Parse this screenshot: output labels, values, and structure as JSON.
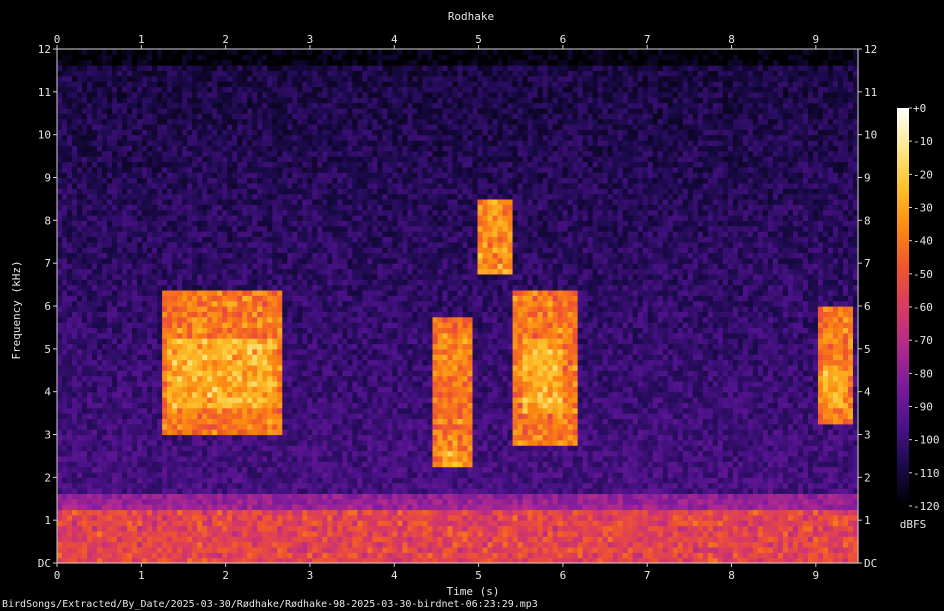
{
  "chart_data": {
    "type": "heatmap",
    "title": "Rodhake",
    "xlabel": "Time (s)",
    "ylabel": "Frequency (kHz)",
    "xlim": [
      0,
      9.5
    ],
    "ylim": [
      0,
      12
    ],
    "x_ticks": [
      "0",
      "1",
      "2",
      "3",
      "4",
      "5",
      "6",
      "7",
      "8",
      "9"
    ],
    "x_tick_values": [
      0,
      1,
      2,
      3,
      4,
      5,
      6,
      7,
      8,
      9
    ],
    "y_ticks": [
      "DC",
      "1",
      "2",
      "3",
      "4",
      "5",
      "6",
      "7",
      "8",
      "9",
      "10",
      "11",
      "12"
    ],
    "y_tick_values": [
      0,
      1,
      2,
      3,
      4,
      5,
      6,
      7,
      8,
      9,
      10,
      11,
      12
    ],
    "colorbar": {
      "label": "dBFS",
      "ticks": [
        "+0",
        "-10",
        "-20",
        "-30",
        "-40",
        "-50",
        "-60",
        "-70",
        "-80",
        "-90",
        "-100",
        "-110",
        "-120"
      ],
      "tick_values": [
        0,
        -10,
        -20,
        -30,
        -40,
        -50,
        -60,
        -70,
        -80,
        -90,
        -100,
        -110,
        -120
      ],
      "range": [
        -120,
        0
      ],
      "colors": [
        "#000000",
        "#1a0a4a",
        "#4b1289",
        "#7a1a9c",
        "#b02a8c",
        "#d93a62",
        "#f0552e",
        "#fb8a12",
        "#fcc12a",
        "#fde88a",
        "#ffffff"
      ]
    },
    "energy_regions": [
      {
        "t": [
          1.25,
          2.7
        ],
        "f": [
          3.0,
          6.4
        ],
        "level": -40
      },
      {
        "t": [
          1.3,
          2.6
        ],
        "f": [
          3.6,
          5.2
        ],
        "level": -28
      },
      {
        "t": [
          4.45,
          4.9
        ],
        "f": [
          2.2,
          5.8
        ],
        "level": -40
      },
      {
        "t": [
          4.55,
          4.85
        ],
        "f": [
          2.3,
          2.6
        ],
        "level": -30
      },
      {
        "t": [
          5.0,
          5.4
        ],
        "f": [
          6.8,
          8.5
        ],
        "level": -35
      },
      {
        "t": [
          5.4,
          6.2
        ],
        "f": [
          2.7,
          6.4
        ],
        "level": -40
      },
      {
        "t": [
          5.5,
          6.0
        ],
        "f": [
          3.5,
          5.2
        ],
        "level": -28
      },
      {
        "t": [
          9.05,
          9.45
        ],
        "f": [
          3.3,
          6.0
        ],
        "level": -40
      },
      {
        "t": [
          9.1,
          9.4
        ],
        "f": [
          3.6,
          4.6
        ],
        "level": -30
      },
      {
        "t": [
          0,
          9.5
        ],
        "f": [
          0,
          1.2
        ],
        "level": -55
      }
    ],
    "source_file": "BirdSongs/Extracted/By_Date/2025-03-30/Rødhake/Rødhake-98-2025-03-30-birdnet-06:23:29.mp3"
  }
}
